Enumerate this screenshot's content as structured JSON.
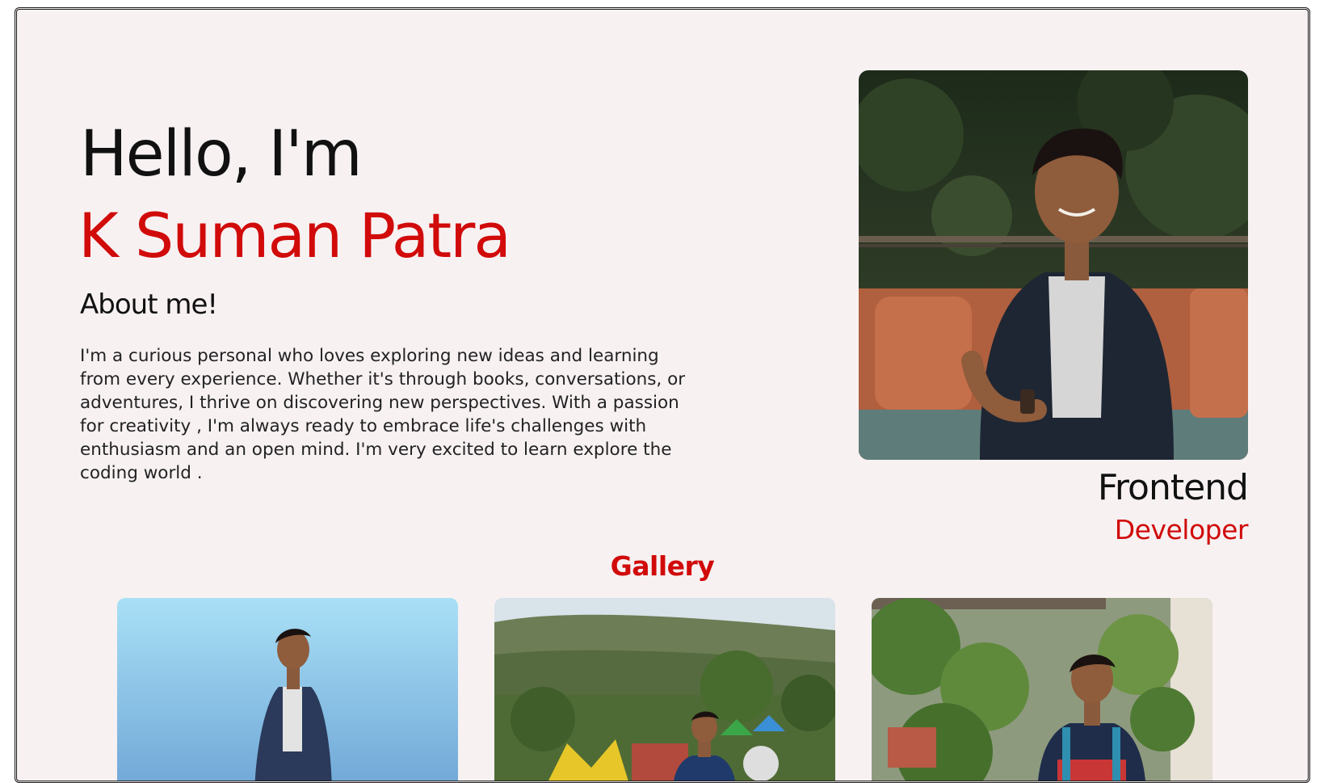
{
  "hero": {
    "greeting": "Hello, I'm",
    "name": "K Suman Patra",
    "about_heading": "About me!",
    "bio": "I'm a curious personal who loves exploring new ideas and learning from every experience. Whether it's through books, conversations, or adventures, I thrive on discovering new perspectives. With a passion for creativity , I'm always ready to embrace life's challenges with enthusiasm and an open mind. I'm very excited to learn explore the coding world ."
  },
  "profile": {
    "photo_icon": "portrait-photo",
    "role_title": "Frontend",
    "role_subtitle": "Developer"
  },
  "gallery": {
    "title": "Gallery",
    "items": [
      {
        "icon": "photo-sky-portrait"
      },
      {
        "icon": "photo-park-portrait"
      },
      {
        "icon": "photo-trees-portrait"
      }
    ]
  },
  "colors": {
    "accent": "#d10a0a",
    "background": "#f7f1f2",
    "text": "#111111"
  }
}
